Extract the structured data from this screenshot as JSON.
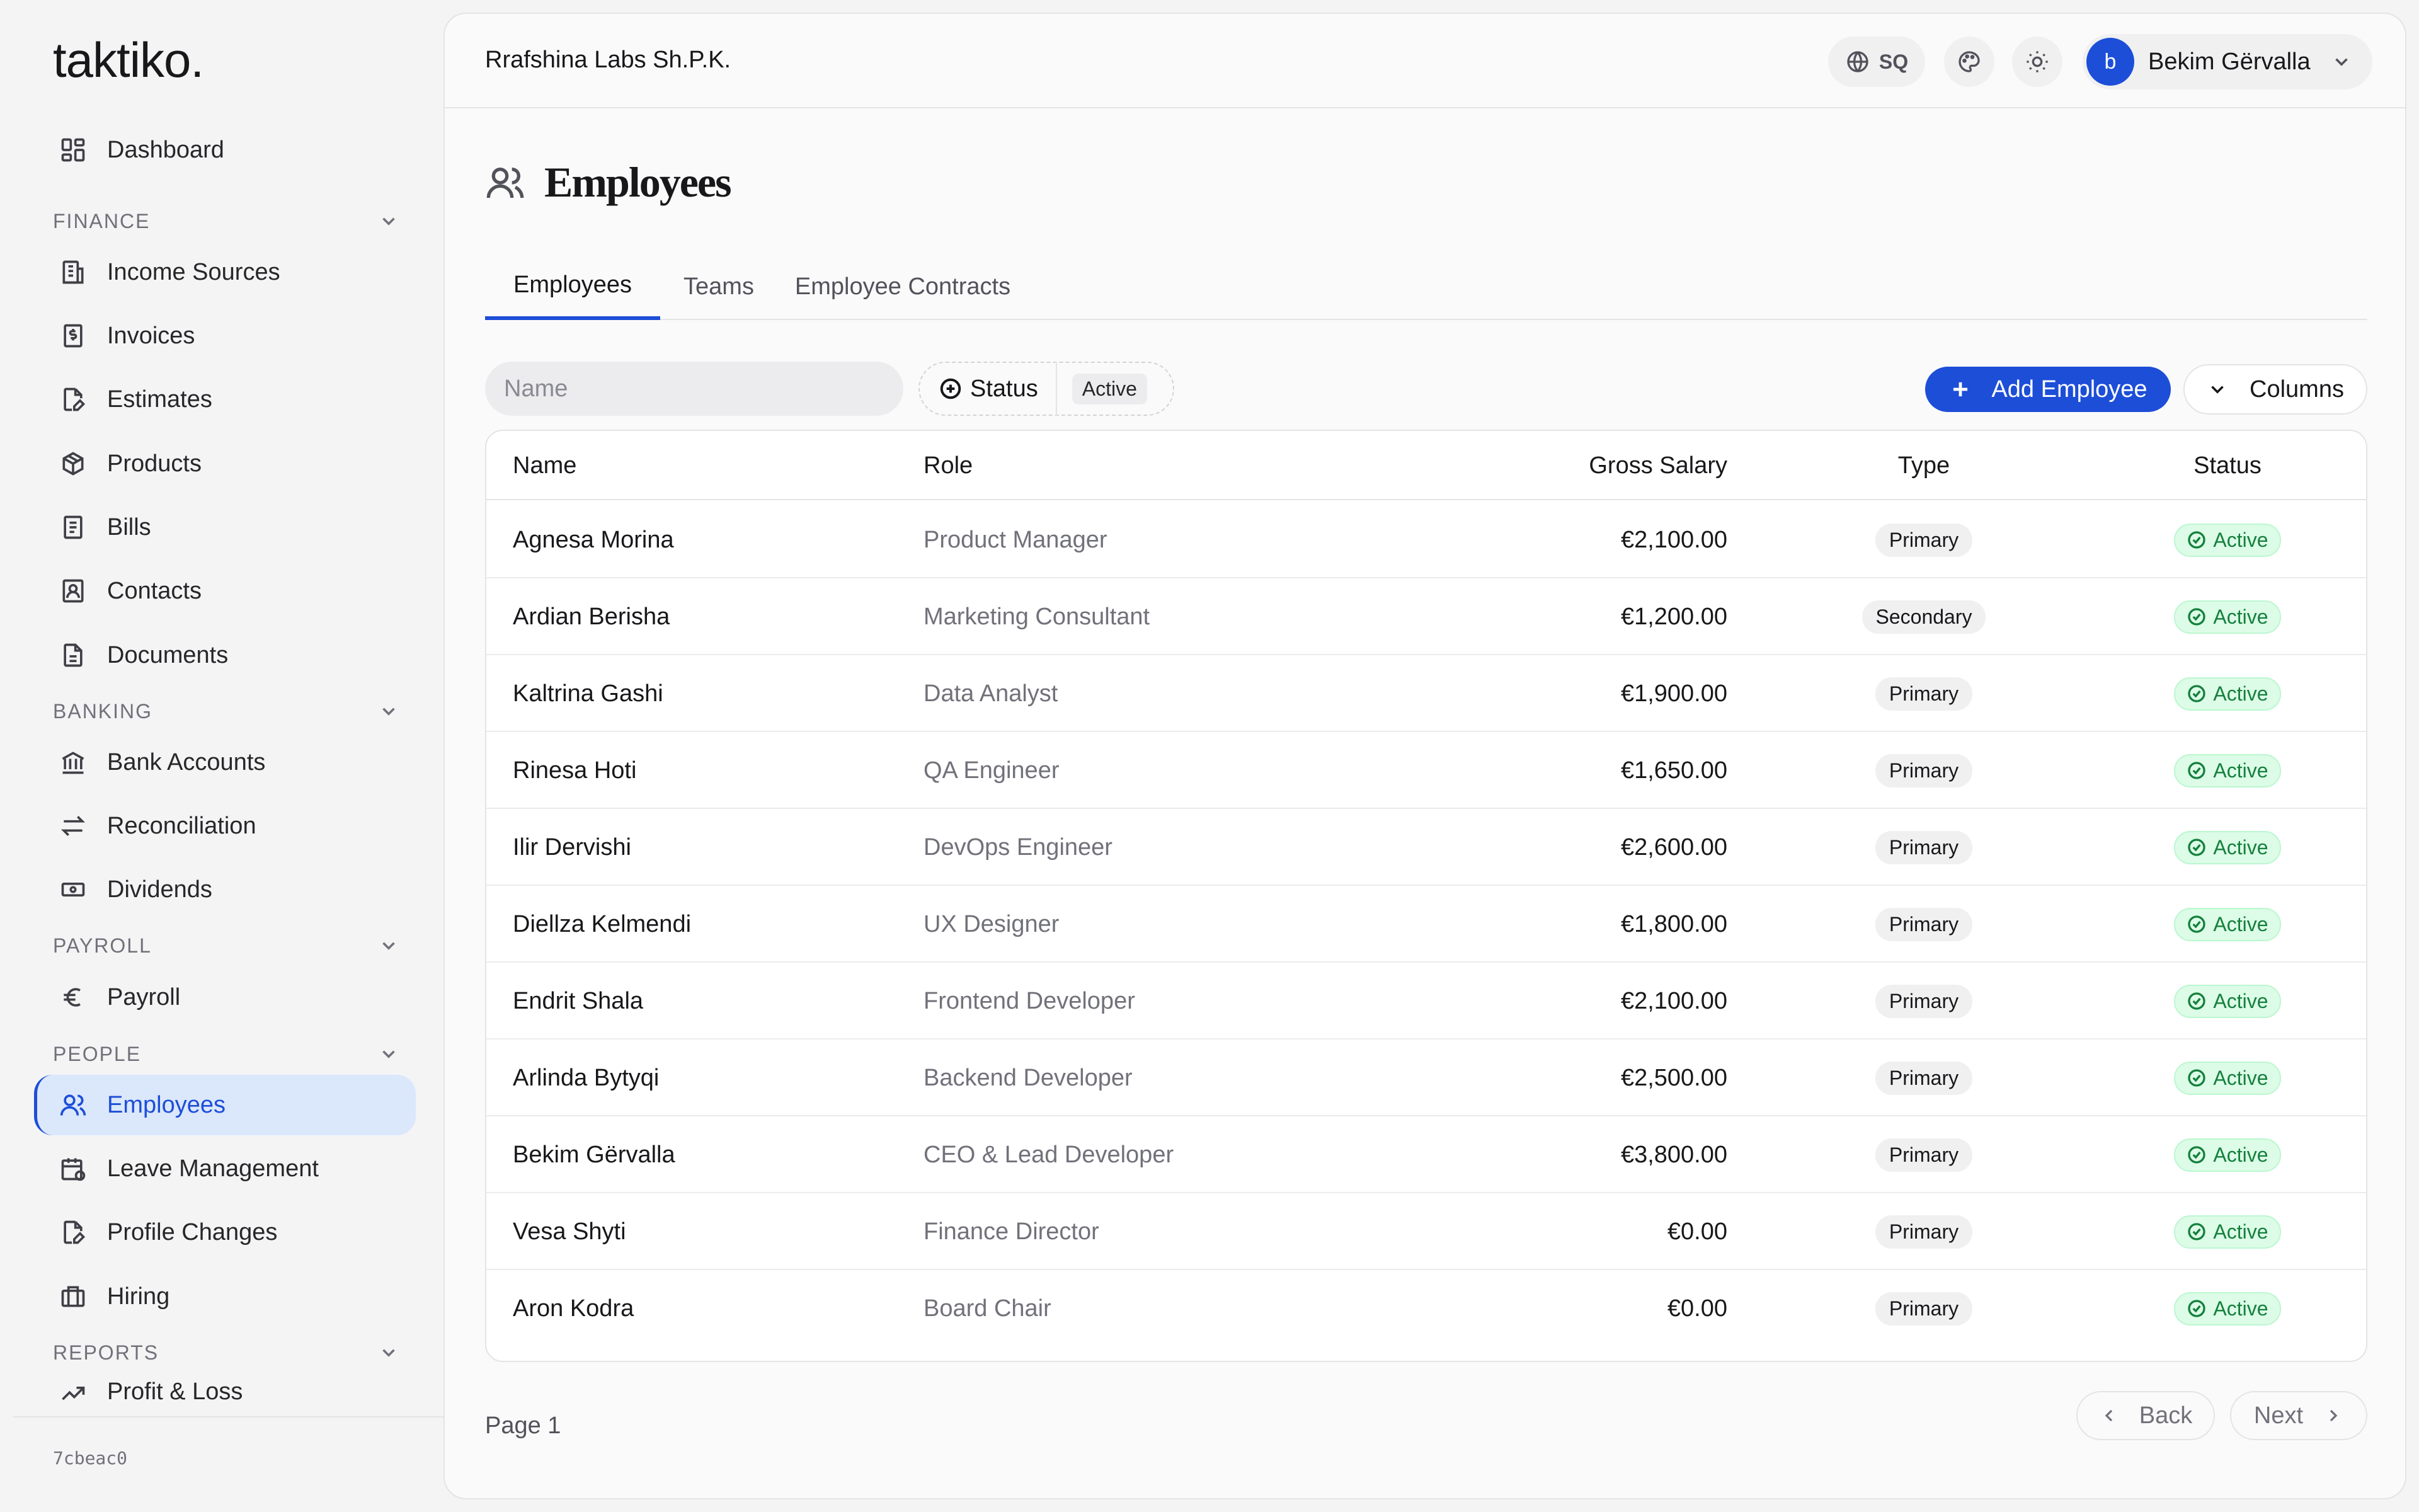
{
  "brand": {
    "logo_text": "taktiko."
  },
  "sidebar": {
    "dashboard": {
      "label": "Dashboard",
      "icon": "dashboard-icon"
    },
    "sections": [
      {
        "label": "FINANCE",
        "items": [
          {
            "label": "Income Sources",
            "icon": "building-icon"
          },
          {
            "label": "Invoices",
            "icon": "invoice-icon"
          },
          {
            "label": "Estimates",
            "icon": "file-edit-icon"
          },
          {
            "label": "Products",
            "icon": "package-icon"
          },
          {
            "label": "Bills",
            "icon": "receipt-icon"
          },
          {
            "label": "Contacts",
            "icon": "contact-icon"
          },
          {
            "label": "Documents",
            "icon": "document-icon"
          }
        ]
      },
      {
        "label": "BANKING",
        "items": [
          {
            "label": "Bank Accounts",
            "icon": "bank-icon"
          },
          {
            "label": "Reconciliation",
            "icon": "arrows-icon"
          },
          {
            "label": "Dividends",
            "icon": "banknote-icon"
          }
        ]
      },
      {
        "label": "PAYROLL",
        "items": [
          {
            "label": "Payroll",
            "icon": "euro-icon"
          }
        ]
      },
      {
        "label": "PEOPLE",
        "items": [
          {
            "label": "Employees",
            "icon": "users-icon",
            "active": true
          },
          {
            "label": "Leave Management",
            "icon": "calendar-icon"
          },
          {
            "label": "Profile Changes",
            "icon": "file-edit-icon"
          },
          {
            "label": "Hiring",
            "icon": "briefcase-icon"
          }
        ]
      },
      {
        "label": "REPORTS",
        "items": [
          {
            "label": "Profit & Loss",
            "icon": "trending-up-icon"
          }
        ]
      }
    ],
    "version": "7cbeac0"
  },
  "header": {
    "company": "Rrafshina Labs Sh.P.K.",
    "language": "SQ",
    "user": {
      "initial": "b",
      "name": "Bekim Gërvalla"
    }
  },
  "page": {
    "title": "Employees",
    "tabs": [
      {
        "label": "Employees",
        "active": true
      },
      {
        "label": "Teams"
      },
      {
        "label": "Employee Contracts"
      }
    ]
  },
  "filters": {
    "name_placeholder": "Name",
    "status_label": "Status",
    "status_value": "Active"
  },
  "actions": {
    "add_employee": "Add Employee",
    "columns": "Columns"
  },
  "table": {
    "columns": {
      "name": "Name",
      "role": "Role",
      "salary": "Gross Salary",
      "type": "Type",
      "status": "Status"
    },
    "rows": [
      {
        "name": "Agnesa Morina",
        "role": "Product Manager",
        "salary": "€2,100.00",
        "type": "Primary",
        "status": "Active"
      },
      {
        "name": "Ardian Berisha",
        "role": "Marketing Consultant",
        "salary": "€1,200.00",
        "type": "Secondary",
        "status": "Active"
      },
      {
        "name": "Kaltrina Gashi",
        "role": "Data Analyst",
        "salary": "€1,900.00",
        "type": "Primary",
        "status": "Active"
      },
      {
        "name": "Rinesa Hoti",
        "role": "QA Engineer",
        "salary": "€1,650.00",
        "type": "Primary",
        "status": "Active"
      },
      {
        "name": "Ilir Dervishi",
        "role": "DevOps Engineer",
        "salary": "€2,600.00",
        "type": "Primary",
        "status": "Active"
      },
      {
        "name": "Diellza Kelmendi",
        "role": "UX Designer",
        "salary": "€1,800.00",
        "type": "Primary",
        "status": "Active"
      },
      {
        "name": "Endrit Shala",
        "role": "Frontend Developer",
        "salary": "€2,100.00",
        "type": "Primary",
        "status": "Active"
      },
      {
        "name": "Arlinda Bytyqi",
        "role": "Backend Developer",
        "salary": "€2,500.00",
        "type": "Primary",
        "status": "Active"
      },
      {
        "name": "Bekim Gërvalla",
        "role": "CEO & Lead Developer",
        "salary": "€3,800.00",
        "type": "Primary",
        "status": "Active"
      },
      {
        "name": "Vesa Shyti",
        "role": "Finance Director",
        "salary": "€0.00",
        "type": "Primary",
        "status": "Active"
      },
      {
        "name": "Aron Kodra",
        "role": "Board Chair",
        "salary": "€0.00",
        "type": "Primary",
        "status": "Active"
      }
    ]
  },
  "pagination": {
    "page_label": "Page 1",
    "back": "Back",
    "next": "Next"
  },
  "colors": {
    "accent": "#1d4ed8",
    "active_nav_bg": "#dbe7fb",
    "status_green": "#15803d",
    "status_green_bg": "#dcfce7"
  }
}
